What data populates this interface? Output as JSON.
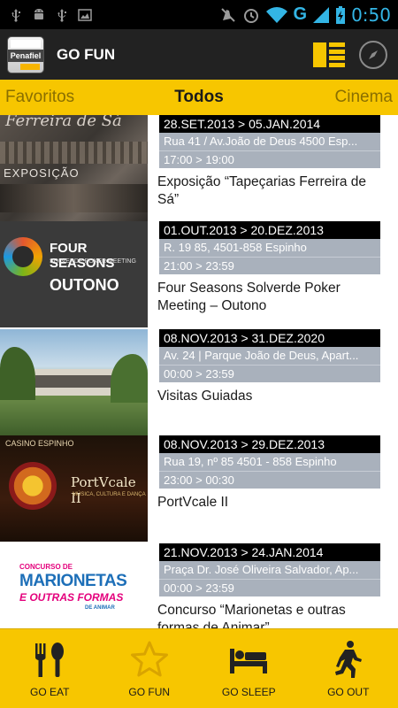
{
  "statusbar": {
    "time": "0:50",
    "network": "G",
    "left_icons": [
      "usb-icon",
      "android-debug-icon",
      "usb-icon",
      "image-icon"
    ],
    "right_icons": [
      "mute-icon",
      "alarm-icon",
      "wifi-icon",
      "signal-icon",
      "battery-charging-icon"
    ]
  },
  "actionbar": {
    "title": "GO FUN",
    "logo_text": "Penafiel",
    "icons": [
      "grid-list-icon",
      "compass-icon"
    ]
  },
  "tabs": {
    "left": "Favoritos",
    "center": "Todos",
    "right": "Cinema"
  },
  "events": [
    {
      "date": "28.SET.2013 > 05.JAN.2014",
      "address": "Rua 41 / Av.João de Deus 4500 Esp...",
      "time": "17:00 > 19:00",
      "title": "Exposição “Tapeçarias Ferreira de Sá”",
      "thumb_text": "Ferreira de Sá",
      "thumb_text2": "EXPOSIÇÃO"
    },
    {
      "date": "01.OUT.2013 > 20.DEZ.2013",
      "address": "R. 19 85, 4501-858 Espinho",
      "time": "21:00 > 23:59",
      "title": "Four Seasons Solverde Poker Meeting – Outono",
      "thumb_text": "FOUR SEASONS",
      "thumb_text2": "SOLVERDE POKER MEETING",
      "thumb_text3": "OUTONO"
    },
    {
      "date": "08.NOV.2013 > 31.DEZ.2020",
      "address": "Av. 24 | Parque João de Deus, Apart...",
      "time": "00:00 > 23:59",
      "title": "Visitas Guiadas"
    },
    {
      "date": "08.NOV.2013 > 29.DEZ.2013",
      "address": "Rua 19, nº 85 4501 - 858 Espinho",
      "time": "23:00 > 00:30",
      "title": "PortVcale II",
      "thumb_text": "CASINO ESPINHO",
      "thumb_text2": "PortVcale II",
      "thumb_text3": "MÚSICA, CULTURA E DANÇA"
    },
    {
      "date": "21.NOV.2013 > 24.JAN.2014",
      "address": "Praça Dr. José Oliveira Salvador, Ap...",
      "time": "00:00 > 23:59",
      "title": "Concurso “Marionetas e outras formas de Animar”",
      "thumb_text": "CONCURSO DE",
      "thumb_text2": "MARIONETAS",
      "thumb_text3": "E OUTRAS FORMAS",
      "thumb_text4": "DE ANIMAR"
    }
  ],
  "bottomnav": [
    {
      "label": "GO EAT",
      "icon": "fork-spoon-icon"
    },
    {
      "label": "GO FUN",
      "icon": "star-icon"
    },
    {
      "label": "GO SLEEP",
      "icon": "bed-icon"
    },
    {
      "label": "GO OUT",
      "icon": "running-man-icon"
    }
  ],
  "colors": {
    "accent": "#f7c600",
    "status_blue": "#33b5e5",
    "info_bar": "#a9b1bc",
    "actionbar": "#222222"
  }
}
